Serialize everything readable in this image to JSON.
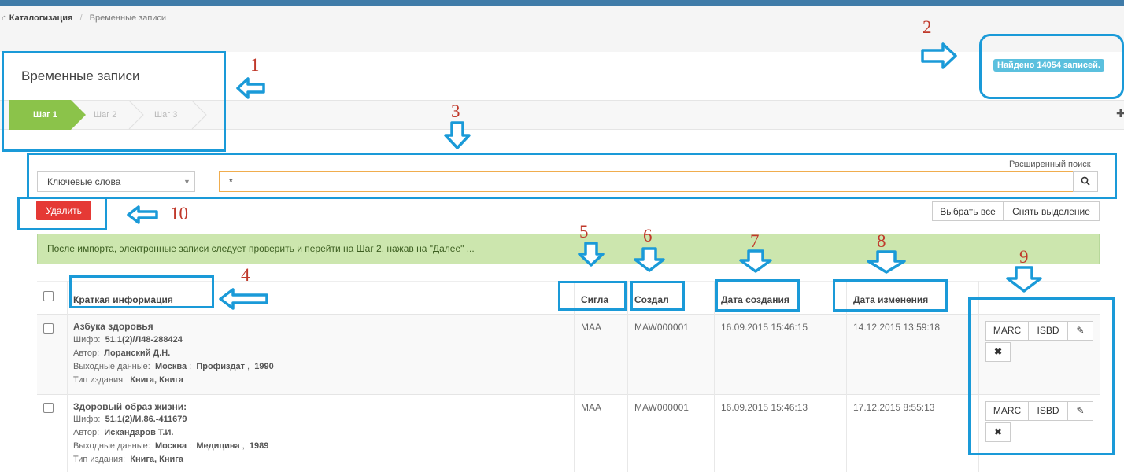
{
  "breadcrumb": {
    "home_icon": "home-icon",
    "root": "Каталогизация",
    "current": "Временные записи"
  },
  "page": {
    "title": "Временные записи",
    "found_badge": "Найдено 14054 записей."
  },
  "steps": [
    {
      "label": "Шаг 1",
      "active": true
    },
    {
      "label": "Шаг 2",
      "active": false
    },
    {
      "label": "Шаг 3",
      "active": false
    }
  ],
  "search": {
    "advanced_link": "Расширенный поиск",
    "mode_selected": "Ключевые слова",
    "query": "*",
    "search_icon": "search-icon"
  },
  "toolbar": {
    "delete_label": "Удалить",
    "select_all_label": "Выбрать все",
    "deselect_label": "Снять выделение"
  },
  "alert": "После импорта, электронные записи следует проверить и перейти на Шаг 2, нажав на \"Далее\" ...",
  "table": {
    "columns": {
      "info": "Краткая информация",
      "sigla": "Сигла",
      "created_by": "Создал",
      "created_at": "Дата создания",
      "modified_at": "Дата изменения"
    },
    "field_labels": {
      "shifr": "Шифр:",
      "author": "Автор:",
      "imprint": "Выходные данные:",
      "type": "Тип издания:"
    },
    "rows": [
      {
        "title": "Азбука здоровья",
        "shifr": "51.1(2)/Л48-288424",
        "author": "Лоранский Д.Н.",
        "imprint_city": "Москва",
        "imprint_publisher": "Профиздат",
        "imprint_year": "1990",
        "type": "Книга, Книга",
        "sigla": "MAA",
        "created_by": "MAW000001",
        "created_at": "16.09.2015 15:46:15",
        "modified_at": "14.12.2015 13:59:18"
      },
      {
        "title": "Здоровый образ жизни:",
        "shifr": "51.1(2)/И.86.-411679",
        "author": "Искандаров Т.И.",
        "imprint_city": "Москва",
        "imprint_publisher": "Медицина",
        "imprint_year": "1989",
        "type": "Книга, Книга",
        "sigla": "MAA",
        "created_by": "MAW000001",
        "created_at": "16.09.2015 15:46:13",
        "modified_at": "17.12.2015 8:55:13"
      }
    ],
    "actions": {
      "marc": "MARC",
      "isbd": "ISBD",
      "edit_icon": "edit-icon",
      "delete_icon": "close-icon"
    }
  },
  "annotations": {
    "labels": [
      "1",
      "2",
      "3",
      "4",
      "5",
      "6",
      "7",
      "8",
      "9",
      "10"
    ],
    "color": "#1a9ad8",
    "number_color": "#c0392b"
  }
}
